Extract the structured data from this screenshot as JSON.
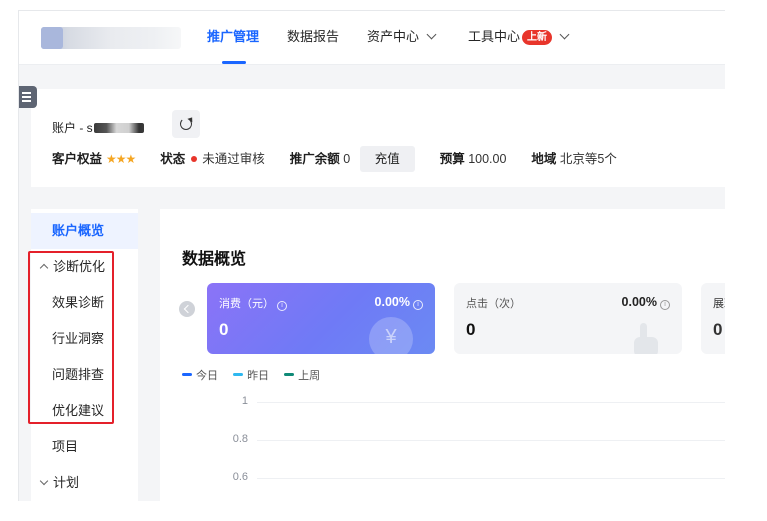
{
  "nav": {
    "items": [
      {
        "label": "推广管理",
        "active": true
      },
      {
        "label": "数据报告"
      },
      {
        "label": "资产中心",
        "dropdown": true
      },
      {
        "label": "工具中心",
        "badge": "上新",
        "dropdown": true
      }
    ]
  },
  "account": {
    "name_prefix": "账户 - s",
    "rights_label": "客户权益",
    "stars": "★★★",
    "status_label": "状态",
    "status_value": "未通过审核",
    "balance_label": "推广余额",
    "balance_value": "0",
    "recharge_label": "充值",
    "budget_label": "预算",
    "budget_value": "100.00",
    "region_label": "地域",
    "region_value": "北京等5个"
  },
  "sidebar": {
    "items": [
      {
        "label": "账户概览",
        "active": true
      },
      {
        "label": "诊断优化",
        "group": true,
        "expanded": true
      },
      {
        "label": "效果诊断"
      },
      {
        "label": "行业洞察"
      },
      {
        "label": "问题排查"
      },
      {
        "label": "优化建议"
      },
      {
        "label": "项目"
      },
      {
        "label": "计划",
        "group": true,
        "expanded": false
      }
    ]
  },
  "overview": {
    "title": "数据概览",
    "cards": [
      {
        "label": "消费（元）",
        "change": "0.00%",
        "value": "0",
        "icon": "yen-icon"
      },
      {
        "label": "点击（次）",
        "change": "0.00%",
        "value": "0",
        "icon": "hand-pointer-icon"
      },
      {
        "label": "展现",
        "value": "0"
      }
    ],
    "legend": [
      {
        "label": "今日",
        "color": "#1a66ff"
      },
      {
        "label": "昨日",
        "color": "#2eb8f0"
      },
      {
        "label": "上周",
        "color": "#0f8a77"
      }
    ],
    "y_ticks": [
      "1",
      "0.8",
      "0.6"
    ]
  },
  "colors": {
    "accent": "#1a66ff",
    "badge": "#e8352b",
    "highlight_box": "#e4202a"
  }
}
